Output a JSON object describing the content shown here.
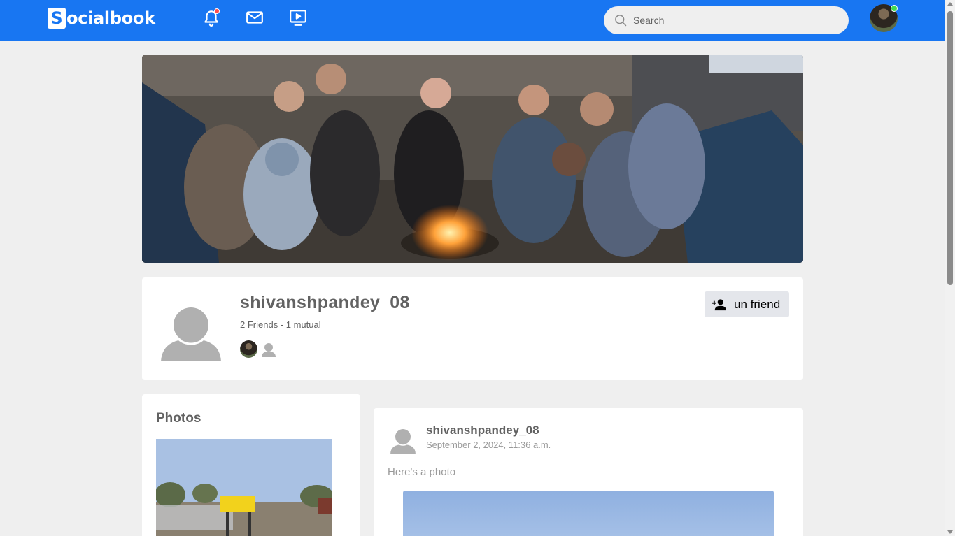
{
  "navbar": {
    "logo_letter": "S",
    "logo_text": "ocialbook",
    "icons": [
      "bell-icon",
      "mail-icon",
      "video-icon"
    ],
    "search_placeholder": "Search",
    "brand_color": "#1876f2",
    "online_color": "#41db51"
  },
  "profile": {
    "username": "shivanshpandey_08",
    "friends_summary": "2 Friends - 1 mutual",
    "unfriend_label": "un friend"
  },
  "photos": {
    "title": "Photos"
  },
  "post": {
    "author": "shivanshpandey_08",
    "date": "September 2, 2024, 11:36 a.m.",
    "text": "Here's a photo"
  }
}
